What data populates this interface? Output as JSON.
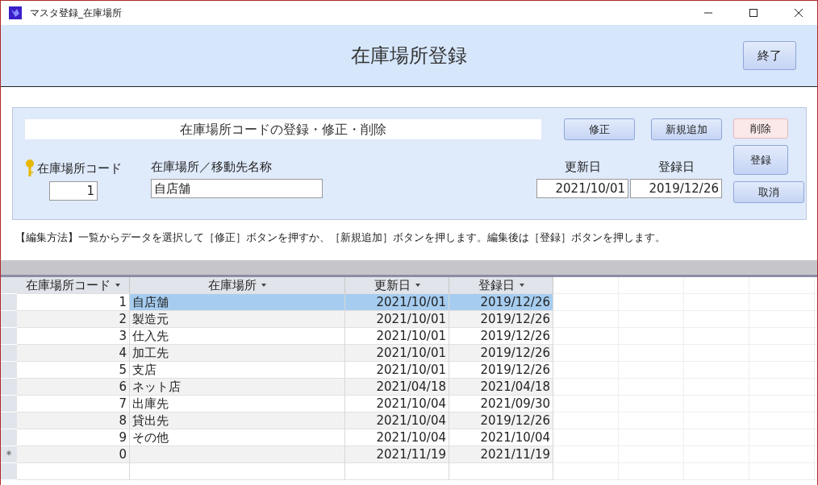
{
  "window": {
    "title": "マスタ登録_在庫場所"
  },
  "header": {
    "title": "在庫場所登録",
    "exit_button": "終了"
  },
  "form": {
    "section_title": "在庫場所コードの登録・修正・削除",
    "buttons": [
      {
        "label": "修正",
        "kind": "normal"
      },
      {
        "label": "新規追加",
        "kind": "normal"
      },
      {
        "label": "削除",
        "kind": "danger"
      }
    ],
    "side_buttons": [
      {
        "label": "登録",
        "kind": "tall"
      },
      {
        "label": "取消",
        "kind": "normal"
      }
    ],
    "code_label": "在庫場所コード",
    "code_value": "1",
    "name_label": "在庫場所／移動先名称",
    "name_value": "自店舗",
    "updated_label": "更新日",
    "updated_value": "2021/10/01",
    "registered_label": "登録日",
    "registered_value": "2019/12/26"
  },
  "instructions": "【編集方法】一覧からデータを選択して［修正］ボタンを押すか、［新規追加］ボタンを押します。編集後は［登録］ボタンを押します。",
  "table": {
    "columns": [
      "在庫場所コード",
      "在庫場所",
      "更新日",
      "登録日"
    ],
    "rows": [
      {
        "kind": "data",
        "selected": true,
        "cells": [
          "1",
          "自店舗",
          "2021/10/01",
          "2019/12/26"
        ]
      },
      {
        "kind": "data",
        "selected": false,
        "cells": [
          "2",
          "製造元",
          "2021/10/01",
          "2019/12/26"
        ]
      },
      {
        "kind": "data",
        "selected": false,
        "cells": [
          "3",
          "仕入先",
          "2021/10/01",
          "2019/12/26"
        ]
      },
      {
        "kind": "data",
        "selected": false,
        "cells": [
          "4",
          "加工先",
          "2021/10/01",
          "2019/12/26"
        ]
      },
      {
        "kind": "data",
        "selected": false,
        "cells": [
          "5",
          "支店",
          "2021/10/01",
          "2019/12/26"
        ]
      },
      {
        "kind": "data",
        "selected": false,
        "cells": [
          "6",
          "ネット店",
          "2021/04/18",
          "2021/04/18"
        ]
      },
      {
        "kind": "data",
        "selected": false,
        "cells": [
          "7",
          "出庫先",
          "2021/10/04",
          "2021/09/30"
        ]
      },
      {
        "kind": "data",
        "selected": false,
        "cells": [
          "8",
          "貸出先",
          "2021/10/04",
          "2019/12/26"
        ]
      },
      {
        "kind": "data",
        "selected": false,
        "cells": [
          "9",
          "その他",
          "2021/10/04",
          "2021/10/04"
        ]
      },
      {
        "kind": "new",
        "selected": false,
        "marker": "*",
        "cells": [
          "0",
          "",
          "2021/11/19",
          "2021/11/19"
        ]
      }
    ]
  }
}
